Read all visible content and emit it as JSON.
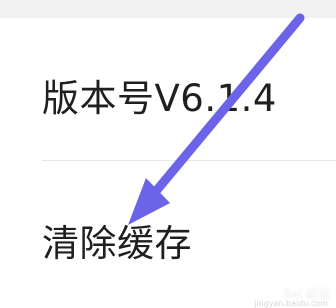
{
  "settings": {
    "version_label": "版本号V6.1.4",
    "clear_cache_label": "清除缓存"
  },
  "annotation": {
    "arrow_color": "#6b63e8"
  },
  "watermark": {
    "brand_text": "Bai 经验",
    "url_text": "jingyan.baidu.com"
  }
}
